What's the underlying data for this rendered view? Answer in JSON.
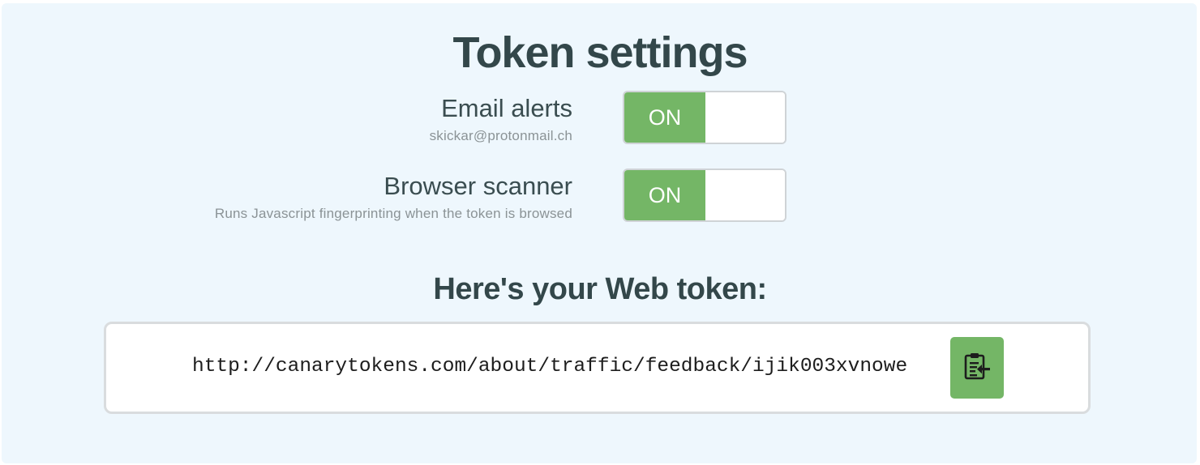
{
  "page": {
    "title": "Token settings"
  },
  "settings": [
    {
      "name": "Email alerts",
      "description": "skickar@protonmail.ch",
      "state": "ON",
      "enabled": true
    },
    {
      "name": "Browser scanner",
      "description": "Runs Javascript fingerprinting when the token is browsed",
      "state": "ON",
      "enabled": true
    }
  ],
  "token": {
    "heading": "Here's your Web token:",
    "url": "http://canarytokens.com/about/traffic/feedback/ijik003xvnowe",
    "copy_icon": "clipboard-copy-icon"
  },
  "colors": {
    "background": "#eef7fd",
    "accent_green": "#74b666",
    "heading_text": "#33474a",
    "muted_text": "#8b9396"
  }
}
